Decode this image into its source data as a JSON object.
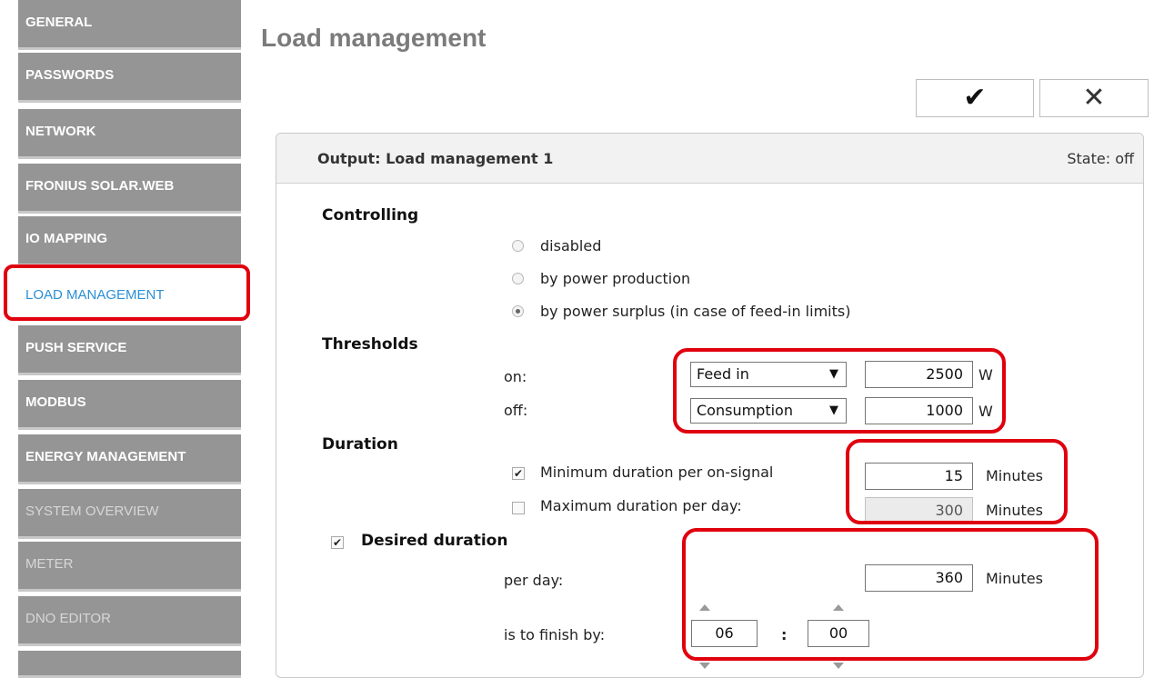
{
  "sidebar": {
    "items": [
      {
        "label": "GENERAL"
      },
      {
        "label": "PASSWORDS"
      },
      {
        "label": "NETWORK"
      },
      {
        "label": "FRONIUS SOLAR.WEB"
      },
      {
        "label": "IO MAPPING"
      },
      {
        "label": "LOAD MANAGEMENT"
      },
      {
        "label": "PUSH SERVICE"
      },
      {
        "label": "MODBUS"
      },
      {
        "label": "ENERGY MANAGEMENT"
      },
      {
        "label": "SYSTEM OVERVIEW"
      },
      {
        "label": "METER"
      },
      {
        "label": "DNO EDITOR"
      }
    ],
    "active_item": "LOAD MANAGEMENT"
  },
  "header": {
    "title": "Load management",
    "ok_icon": "✔",
    "cancel_icon": "✕"
  },
  "panel": {
    "output_title": "Output: Load management 1",
    "state": "State: off",
    "controlling": {
      "heading": "Controlling",
      "options": [
        "disabled",
        "by power production",
        "by power surplus (in case of feed-in limits)"
      ],
      "selected": "by power surplus (in case of feed-in limits)"
    },
    "thresholds": {
      "heading": "Thresholds",
      "on_label": "on:",
      "on_select": "Feed in",
      "on_value": "2500",
      "off_label": "off:",
      "off_select": "Consumption",
      "off_value": "1000",
      "unit": "W"
    },
    "duration": {
      "heading": "Duration",
      "min_label": "Minimum duration per on-signal",
      "min_checked": true,
      "min_value": "15",
      "max_label": "Maximum duration per day:",
      "max_checked": false,
      "max_value": "300",
      "unit": "Minutes"
    },
    "desired": {
      "heading": "Desired duration",
      "checked": true,
      "per_day_label": "per day:",
      "per_day_value": "360",
      "unit": "Minutes",
      "finish_label": "is to finish by:",
      "hour": "06",
      "separator": ":",
      "minute": "00"
    }
  },
  "colors": {
    "sidebar_bg": "#959595",
    "active_link": "#2a8fd6",
    "highlight": "#e0000e"
  }
}
